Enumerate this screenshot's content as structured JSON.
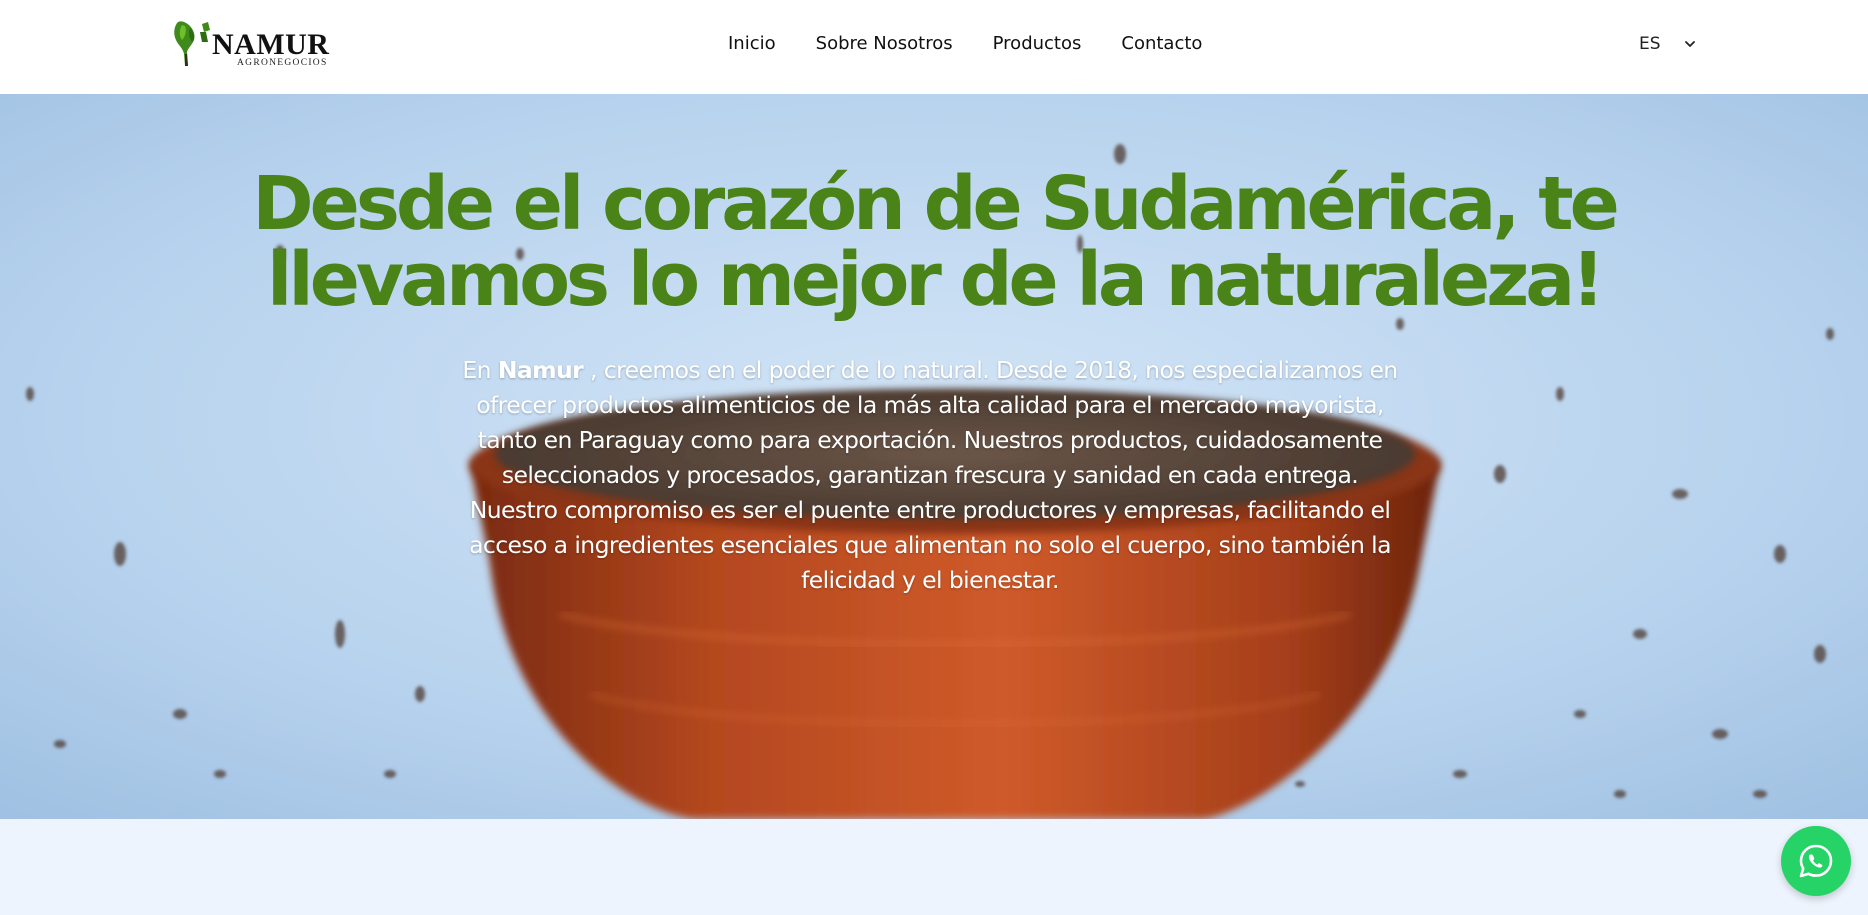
{
  "brand": {
    "name": "NAMUR",
    "tagline": "AGRONEGOCIOS",
    "accent_color": "#4a8317"
  },
  "nav": {
    "items": [
      "Inicio",
      "Sobre Nosotros",
      "Productos",
      "Contacto"
    ]
  },
  "language": {
    "selected": "ES"
  },
  "hero": {
    "title": "Desde el corazón de Sudamérica, te llevamos lo mejor de la naturaleza!",
    "text_prefix": "En ",
    "text_brand": "Namur",
    "text_body": " , creemos en el poder de lo natural. Desde 2018, nos especializamos en ofrecer productos alimenticios de la más alta calidad para el mercado mayorista, tanto en Paraguay como para exportación. Nuestros productos, cuidadosamente seleccionados y procesados, garantizan frescura y sanidad en cada entrega. Nuestro compromiso es ser el puente entre productores y empresas, facilitando el acceso a ingredientes esenciales que alimentan no solo el cuerpo, sino también la felicidad y el bienestar."
  },
  "whatsapp": {
    "icon": "whatsapp-icon",
    "color": "#25d366"
  }
}
